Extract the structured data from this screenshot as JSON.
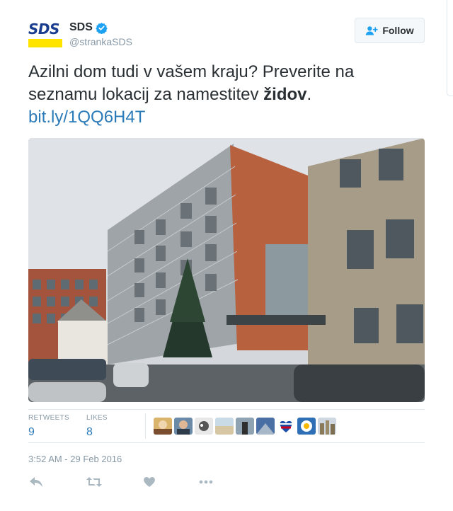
{
  "account": {
    "display_name": "SDS",
    "screen_name": "@strankaSDS",
    "verified": true,
    "logo_text": "SDS"
  },
  "follow_button": {
    "label": "Follow"
  },
  "tweet": {
    "text_before": "Azilni dom tudi v vašem kraju? Preverite na seznamu lokacij za namestitev ",
    "text_bold": "židov",
    "text_after": ".",
    "link": "bit.ly/1QQ6H4T"
  },
  "stats": {
    "retweets_label": "RETWEETS",
    "retweets_count": "9",
    "likes_label": "LIKES",
    "likes_count": "8"
  },
  "timestamp": "3:52 AM - 29 Feb 2016",
  "colors": {
    "link": "#2b7bb9",
    "muted": "#8899a6",
    "border": "#e1e8ed",
    "verified": "#1da1f2",
    "logo_blue": "#1a3d8f",
    "logo_yellow": "#ffe400"
  },
  "icons": [
    "verified-badge-icon",
    "follow-person-plus-icon",
    "reply-icon",
    "retweet-icon",
    "like-heart-icon",
    "more-dots-icon"
  ]
}
